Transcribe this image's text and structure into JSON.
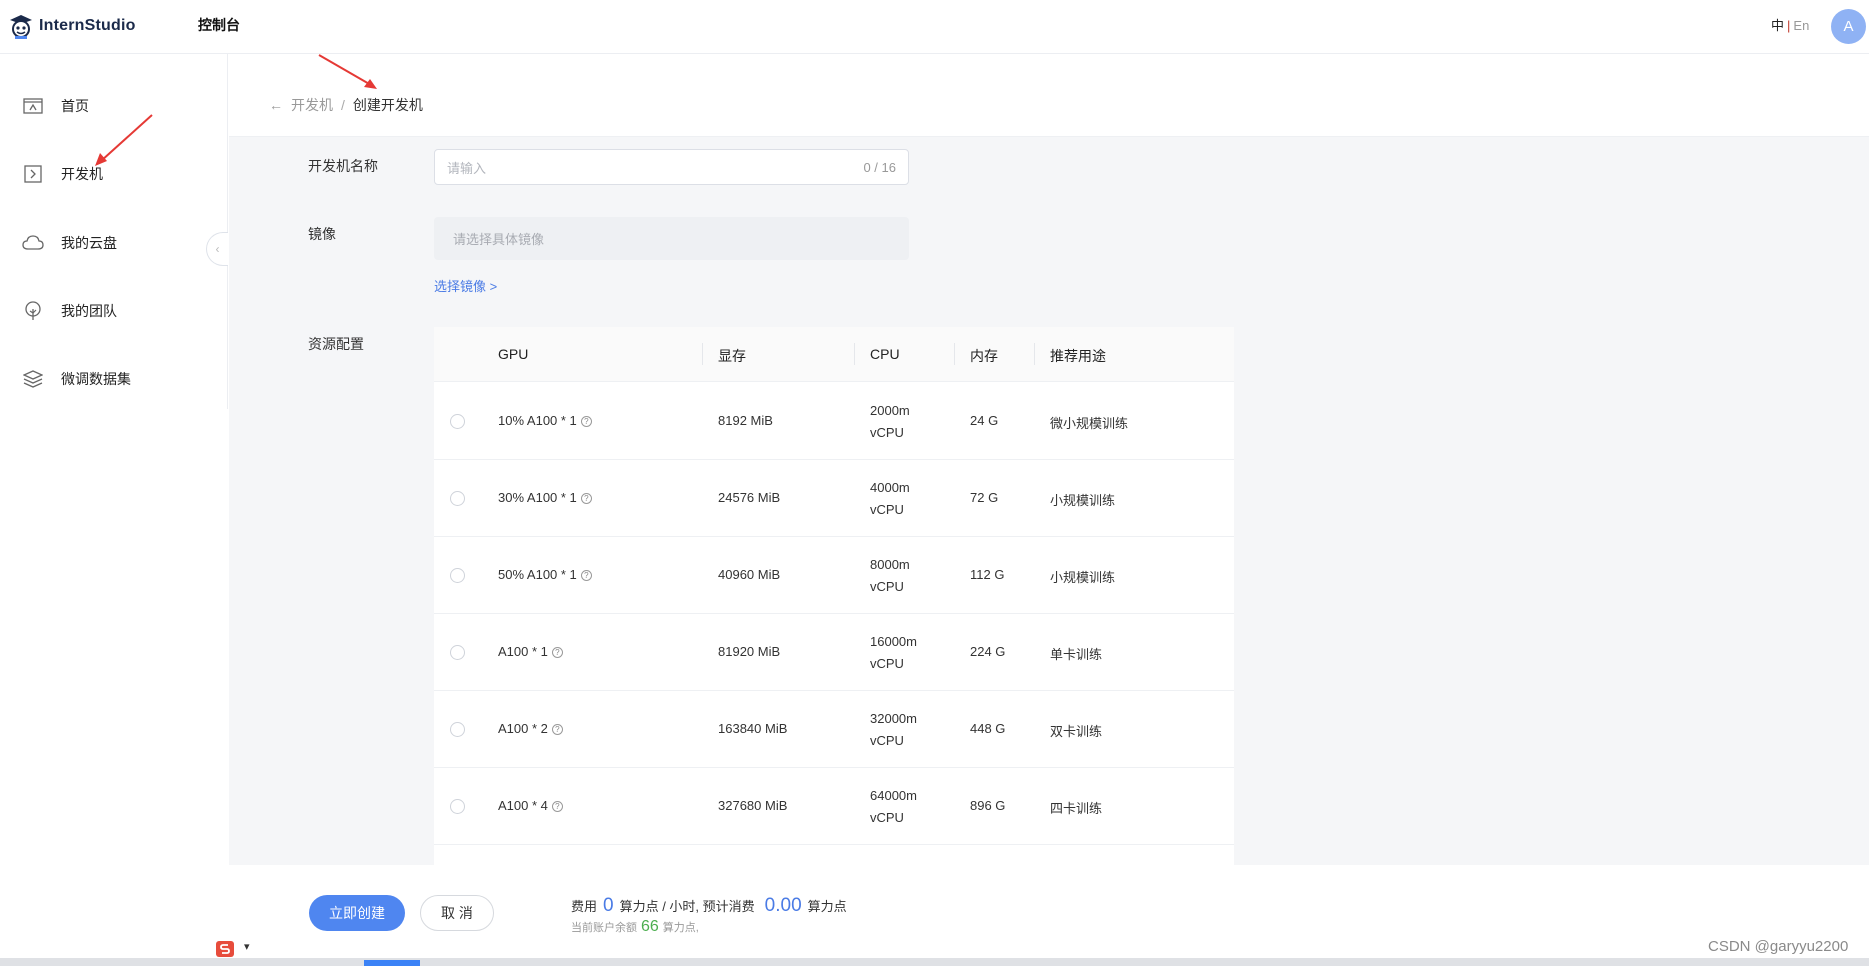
{
  "app": {
    "logo_text": "InternStudio",
    "console_title": "控制台",
    "lang_current": "中",
    "lang_separator": "|",
    "lang_other": "En",
    "avatar_initial": "A"
  },
  "sidebar": {
    "items": [
      {
        "label": "首页",
        "icon": "home-icon"
      },
      {
        "label": "开发机",
        "icon": "terminal-icon"
      },
      {
        "label": "我的云盘",
        "icon": "cloud-icon"
      },
      {
        "label": "我的团队",
        "icon": "tree-icon"
      },
      {
        "label": "微调数据集",
        "icon": "layers-icon"
      }
    ],
    "collapse_glyph": "‹"
  },
  "breadcrumb": {
    "back_glyph": "←",
    "parent": "开发机",
    "separator": "/",
    "current": "创建开发机"
  },
  "form": {
    "name_label": "开发机名称",
    "name_placeholder": "请输入",
    "name_counter": "0 / 16",
    "image_label": "镜像",
    "image_placeholder": "请选择具体镜像",
    "image_link": "选择镜像 >",
    "resource_label": "资源配置"
  },
  "table": {
    "headers": {
      "gpu": "GPU",
      "memory": "显存",
      "cpu": "CPU",
      "ram": "内存",
      "usage": "推荐用途"
    },
    "rows": [
      {
        "gpu": "10% A100 * 1",
        "memory": "8192 MiB",
        "cpu_cores": "2000m",
        "cpu_unit": "vCPU",
        "ram": "24 G",
        "usage": "微小规模训练"
      },
      {
        "gpu": "30% A100 * 1",
        "memory": "24576 MiB",
        "cpu_cores": "4000m",
        "cpu_unit": "vCPU",
        "ram": "72 G",
        "usage": "小规模训练"
      },
      {
        "gpu": "50% A100 * 1",
        "memory": "40960 MiB",
        "cpu_cores": "8000m",
        "cpu_unit": "vCPU",
        "ram": "112 G",
        "usage": "小规模训练"
      },
      {
        "gpu": "A100 * 1",
        "memory": "81920 MiB",
        "cpu_cores": "16000m",
        "cpu_unit": "vCPU",
        "ram": "224 G",
        "usage": "单卡训练"
      },
      {
        "gpu": "A100 * 2",
        "memory": "163840 MiB",
        "cpu_cores": "32000m",
        "cpu_unit": "vCPU",
        "ram": "448 G",
        "usage": "双卡训练"
      },
      {
        "gpu": "A100 * 4",
        "memory": "327680 MiB",
        "cpu_cores": "64000m",
        "cpu_unit": "vCPU",
        "ram": "896 G",
        "usage": "四卡训练"
      }
    ],
    "help_glyph": "?"
  },
  "footer": {
    "create_button": "立即创建",
    "cancel_button": "取 消",
    "fee_label": "费用",
    "fee_value": "0",
    "fee_unit": "算力点 / 小时, 预计消费",
    "total_value": "0.00",
    "total_unit": "算力点",
    "balance_label": "当前账户余额",
    "balance_value": "66",
    "balance_unit": "算力点,"
  },
  "watermark": "CSDN @garyyu2200",
  "colors": {
    "primary": "#4f86f0",
    "link": "#4a7be5",
    "balance_green": "#4cae4f",
    "annotation_red": "#e53935"
  }
}
